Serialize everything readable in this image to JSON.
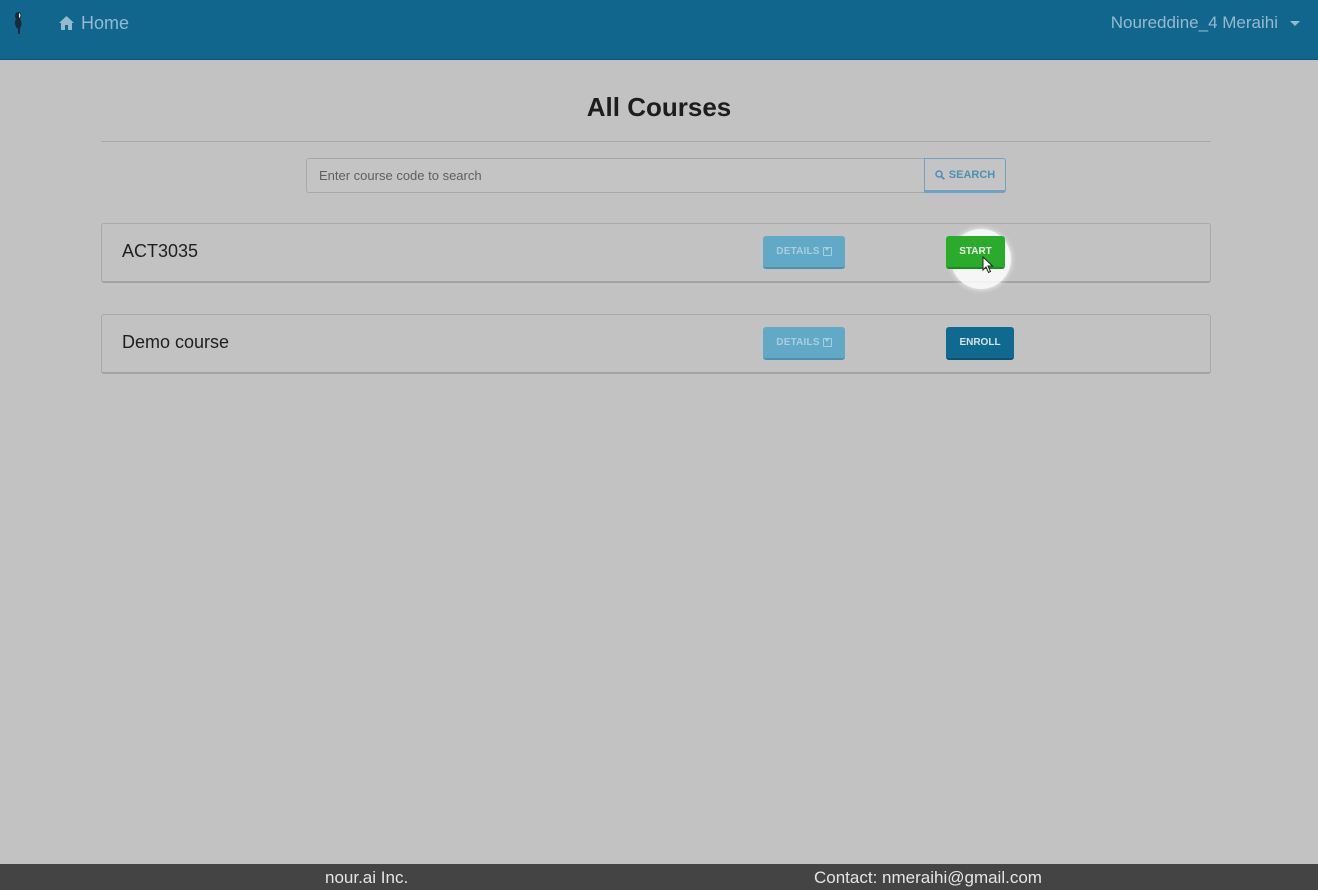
{
  "navbar": {
    "brand_icon": "logo-icon",
    "home_icon": "home-icon",
    "home_label": "Home",
    "user_name": "Noureddine_4 Meraihi",
    "user_menu_icon": "caret-down-icon"
  },
  "main": {
    "title": "All Courses",
    "search": {
      "placeholder": "Enter course code to search",
      "value": "",
      "button_icon": "search-icon",
      "button_label": "SEARCH"
    },
    "courses": [
      {
        "name": "ACT3035",
        "details_label": "DETAILS",
        "action_label": "START",
        "action_color": "#2bab2b"
      },
      {
        "name": "Demo course",
        "details_label": "DETAILS",
        "action_label": "ENROLL",
        "action_color": "#106a8f"
      }
    ]
  },
  "footer": {
    "company": "nour.ai Inc.",
    "contact": "Contact: nmeraihi@gmail.com"
  },
  "colors": {
    "navbar_bg": "#10668c",
    "page_bg": "#c2c2c2",
    "footer_bg": "#444444"
  }
}
